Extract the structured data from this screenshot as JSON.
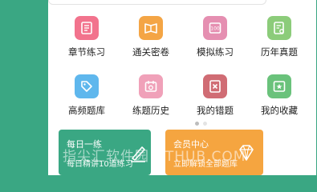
{
  "colors": {
    "background": "#3aa783",
    "chapter": "#f2738d",
    "pass": "#f4a545",
    "mock": "#e58fb1",
    "past": "#8ccc7a",
    "frequent": "#5fb7ed",
    "history": "#f0a1b9",
    "wrong": "#d06c74",
    "collect": "#6ac27b",
    "banner_left": "#3aa783",
    "banner_right": "#f5a540"
  },
  "grid": {
    "items": [
      {
        "label": "章节练习",
        "icon": "chapter-book-icon"
      },
      {
        "label": "通关密卷",
        "icon": "open-book-icon"
      },
      {
        "label": "模拟练习",
        "icon": "score-sheet-icon"
      },
      {
        "label": "历年真题",
        "icon": "exam-paper-icon"
      },
      {
        "label": "高频题库",
        "icon": "tag-icon"
      },
      {
        "label": "练题历史",
        "icon": "calendar-icon"
      },
      {
        "label": "我的错题",
        "icon": "wrong-book-icon"
      },
      {
        "label": "我的收藏",
        "icon": "star-icon"
      }
    ]
  },
  "pager": {
    "active": 0,
    "count": 2
  },
  "banners": {
    "left": {
      "title": "每日一练",
      "subtitle": "每日精讲10道练习",
      "icon": "pen-icon"
    },
    "right": {
      "title": "会员中心",
      "subtitle": "立即解锁全部题库",
      "icon": "diamond-icon"
    }
  },
  "watermark": "指尖汇软件园 UTHUB.COM"
}
